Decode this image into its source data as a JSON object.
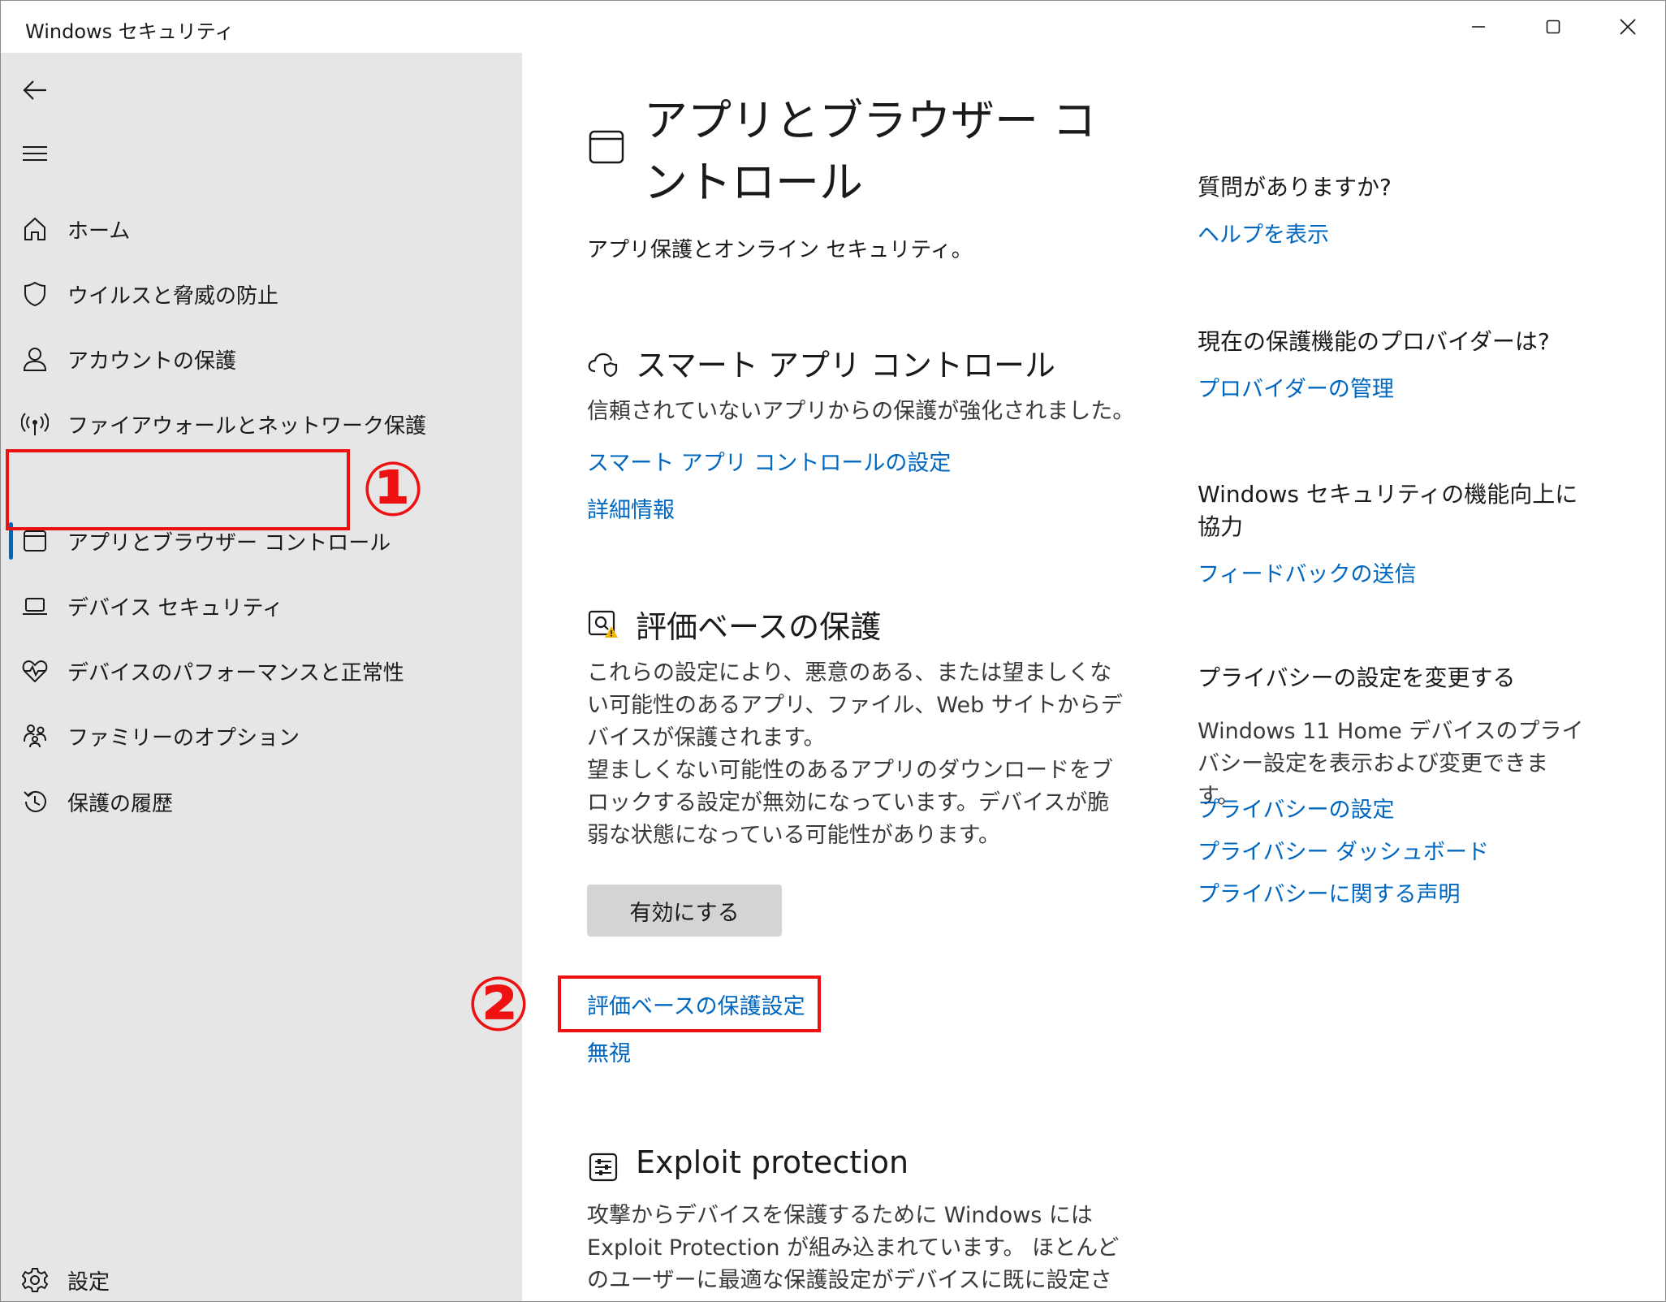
{
  "window": {
    "title": "Windows セキュリティ",
    "controls": {
      "minimize": "minimize-icon",
      "maximize": "maximize-icon",
      "close": "close-icon"
    }
  },
  "sidebar": {
    "back_icon": "back-arrow-icon",
    "menu_icon": "hamburger-icon",
    "items": [
      {
        "label": "ホーム",
        "icon": "home-icon"
      },
      {
        "label": "ウイルスと脅威の防止",
        "icon": "shield-icon"
      },
      {
        "label": "アカウントの保護",
        "icon": "person-icon"
      },
      {
        "label": "ファイアウォールとネットワーク保護",
        "icon": "antenna-icon"
      },
      {
        "label": "アプリとブラウザー コントロール",
        "icon": "app-window-icon",
        "selected": true
      },
      {
        "label": "デバイス セキュリティ",
        "icon": "laptop-icon"
      },
      {
        "label": "デバイスのパフォーマンスと正常性",
        "icon": "heart-pulse-icon"
      },
      {
        "label": "ファミリーのオプション",
        "icon": "family-icon"
      },
      {
        "label": "保護の履歴",
        "icon": "history-icon"
      }
    ],
    "settings": {
      "label": "設定",
      "icon": "gear-icon"
    }
  },
  "annotations": {
    "badge1": "①",
    "badge2": "②",
    "color": "#ee1111"
  },
  "main": {
    "title": "アプリとブラウザー コントロール",
    "subtitle": "アプリ保護とオンライン セキュリティ。",
    "smart_app": {
      "title": "スマート アプリ コントロール",
      "description": "信頼されていないアプリからの保護が強化されました。",
      "link_settings": "スマート アプリ コントロールの設定",
      "link_details": "詳細情報"
    },
    "reputation": {
      "title": "評価ベースの保護",
      "description_1": "これらの設定により、悪意のある、または望ましくない可能性のあるアプリ、ファイル、Web サイトからデバイスが保護されます。",
      "description_2": "望ましくない可能性のあるアプリのダウンロードをブロックする設定が無効になっています。デバイスが脆弱な状態になっている可能性があります。",
      "button": "有効にする",
      "link_settings": "評価ベースの保護設定",
      "link_ignore": "無視"
    },
    "exploit": {
      "title": "Exploit protection",
      "description": "攻撃からデバイスを保護するために Windows には Exploit Protection が組み込まれています。 ほとんどのユーザーに最適な保護設定がデバイスに既に設定されて"
    }
  },
  "right": {
    "help": {
      "heading": "質問がありますか?",
      "link": "ヘルプを表示"
    },
    "provider": {
      "heading": "現在の保護機能のプロバイダーは?",
      "link": "プロバイダーの管理"
    },
    "feedback": {
      "heading": "Windows セキュリティの機能向上に協力",
      "link": "フィードバックの送信"
    },
    "privacy": {
      "heading": "プライバシーの設定を変更する",
      "text": "Windows 11 Home デバイスのプライバシー設定を表示および変更できます。",
      "link_settings": "プライバシーの設定",
      "link_dashboard": "プライバシー ダッシュボード",
      "link_statement": "プライバシーに関する声明"
    }
  },
  "colors": {
    "accent": "#0067c0",
    "sidebar_bg": "#e6e6e6",
    "button_bg": "#d4d4d4",
    "warning": "#f2b600"
  }
}
